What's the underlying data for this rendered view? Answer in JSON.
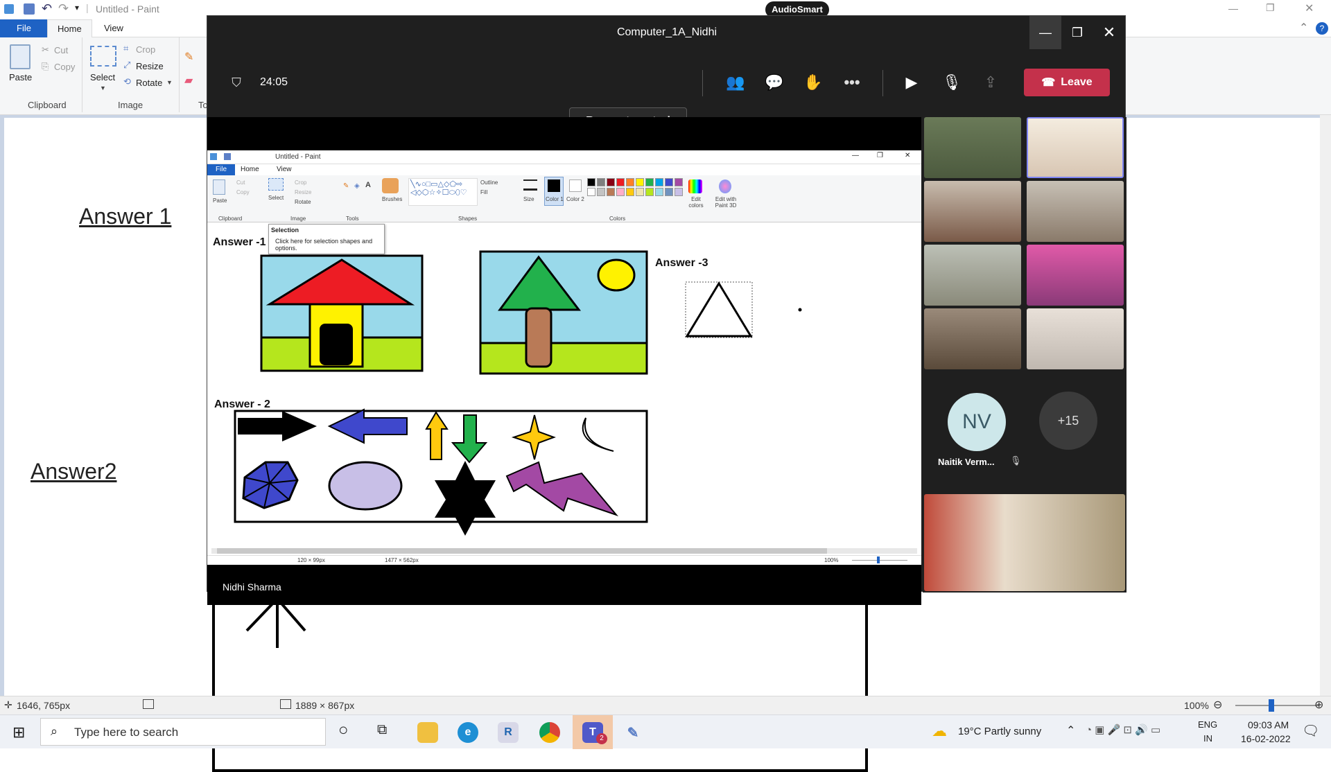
{
  "bg_paint": {
    "title": "Untitled - Paint",
    "tabs": [
      "File",
      "Home",
      "View"
    ],
    "clipboard": {
      "paste": "Paste",
      "cut": "Cut",
      "copy": "Copy",
      "group": "Clipboard"
    },
    "image": {
      "select": "Select",
      "crop": "Crop",
      "resize": "Resize",
      "rotate": "Rotate",
      "group": "Image"
    },
    "tools_partial": "To",
    "canvas_texts": {
      "answer1": "Answer 1",
      "answer2": "Answer2"
    },
    "status": {
      "cursor": "1646, 765px",
      "size": "1889 × 867px",
      "zoom": "100%"
    }
  },
  "audiosmart": "AudioSmart",
  "teams": {
    "title": "Computer_1A_Nidhi",
    "timer": "24:05",
    "request_control": "Request control",
    "leave": "Leave",
    "presenter": "Nidhi Sharma",
    "participant_initials": "NV",
    "participant_name": "Naitik Verm...",
    "more_count": "+15"
  },
  "shared_paint": {
    "title": "Untitled - Paint",
    "tabs": [
      "File",
      "Home",
      "View"
    ],
    "groups": [
      "Clipboard",
      "Image",
      "Tools",
      "Shapes",
      "Colors"
    ],
    "buttons": {
      "paste": "Paste",
      "cut": "Cut",
      "copy": "Copy",
      "select": "Select",
      "crop": "Crop",
      "resize": "Resize",
      "rotate": "Rotate",
      "brushes": "Brushes",
      "outline": "Outline",
      "fill": "Fill",
      "size": "Size",
      "color1": "Color 1",
      "color2": "Color 2",
      "edit_colors": "Edit colors",
      "paint3d": "Edit with Paint 3D"
    },
    "tooltip": {
      "title": "Selection",
      "text": "Click here for selection shapes and options."
    },
    "labels": {
      "a1": "Answer -1",
      "a2": "Answer - 2",
      "a3": "Answer -3"
    },
    "status": {
      "selection": "120 × 99px",
      "size": "1477 × 562px",
      "zoom": "100%"
    },
    "palette": [
      "#000000",
      "#7f7f7f",
      "#880015",
      "#ed1c24",
      "#ff7f27",
      "#fff200",
      "#22b14c",
      "#00a2e8",
      "#3f48cc",
      "#a349a4",
      "#ffffff",
      "#c3c3c3",
      "#b97a57",
      "#ffaec9",
      "#ffc90e",
      "#efe4b0",
      "#b5e61d",
      "#99d9ea",
      "#7092be",
      "#c8bfe7"
    ]
  },
  "taskbar": {
    "search_placeholder": "Type here to search",
    "weather": "19°C  Partly sunny",
    "lang1": "ENG",
    "lang2": "IN",
    "time": "09:03 AM",
    "date": "16-02-2022",
    "teams_badge": "2"
  }
}
